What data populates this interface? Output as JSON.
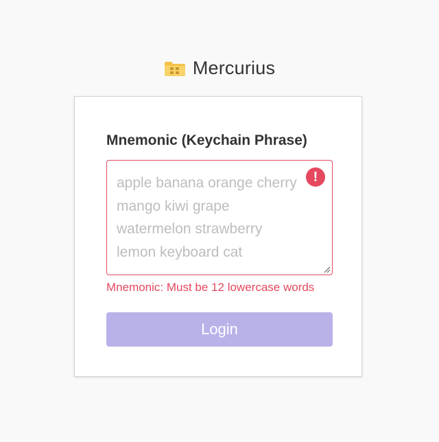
{
  "brand": {
    "logo_icon": "folder-icon",
    "name": "Mercurius"
  },
  "form": {
    "label": "Mnemonic (Keychain Phrase)",
    "mnemonic": {
      "value": "",
      "placeholder": "apple banana orange cherry\nmango kiwi grape\nwatermelon strawberry\nlemon keyboard cat",
      "state": "invalid"
    },
    "error_icon": "exclamation-icon",
    "error_message": "Mnemonic: Must be 12 lowercase words",
    "login_label": "Login",
    "login_disabled": true
  },
  "colors": {
    "background": "#f9f9f9",
    "error": "#e5485f",
    "button": "#b9b2e9",
    "logo": "#f4c14a"
  }
}
